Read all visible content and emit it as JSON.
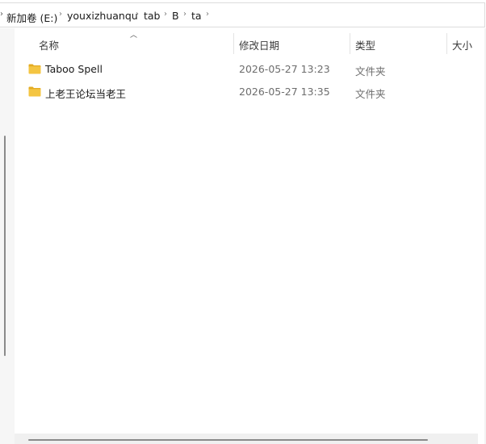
{
  "breadcrumb": {
    "items": [
      "新加卷 (E:)",
      "youxizhuanqu",
      "tab",
      "B",
      "ta"
    ]
  },
  "columns": {
    "name": "名称",
    "date": "修改日期",
    "type": "类型",
    "size": "大小"
  },
  "files": [
    {
      "name": "Taboo Spell",
      "date": "2026-05-27 13:23",
      "type": "文件夹",
      "icon": "folder-icon"
    },
    {
      "name": "上老王论坛当老王",
      "date": "2026-05-27 13:35",
      "type": "文件夹",
      "icon": "folder-icon"
    }
  ],
  "colors": {
    "folder": "#f4c542",
    "folder_tab": "#e3ab22"
  }
}
